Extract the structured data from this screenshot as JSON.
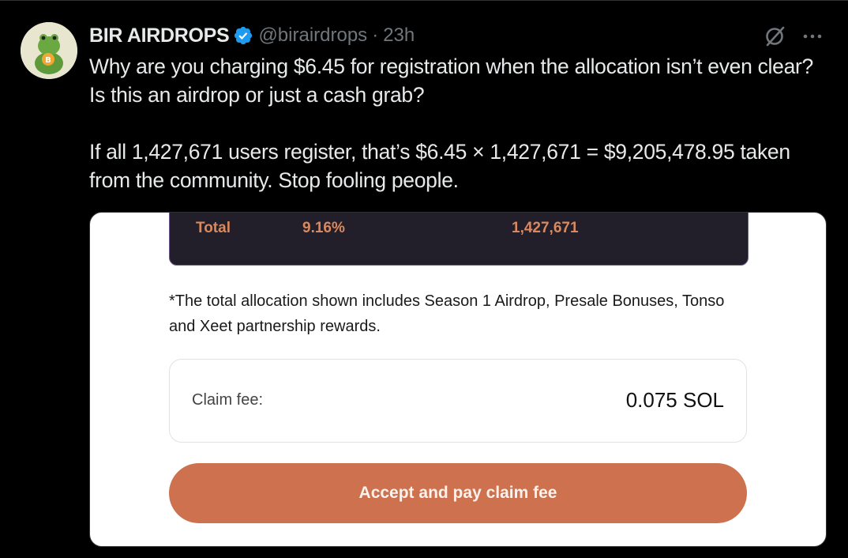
{
  "tweet": {
    "author_name": "BIR AIRDROPS",
    "handle": "@birairdrops",
    "separator": "·",
    "time": "23h",
    "more_label": "···",
    "text_line1": "Why are you charging $6.45 for registration when the allocation isn’t even clear? Is this an airdrop or just a cash grab?",
    "text_line2": "If all 1,427,671 users register, that’s $6.45 × 1,427,671 = $9,205,478.95 taken from the community. Stop fooling people."
  },
  "media": {
    "total_label": "Total",
    "total_percent": "9.16%",
    "total_users": "1,427,671",
    "note": "*The total allocation shown includes Season 1 Airdrop, Presale Bonuses, Tonso and Xeet partnership rewards.",
    "claim_fee_label": "Claim fee:",
    "claim_fee_value": "0.075 SOL",
    "accept_button": "Accept and pay claim fee"
  },
  "colors": {
    "background": "#000000",
    "text": "#e7e9ea",
    "muted": "#71767b",
    "verified": "#1d9bf0",
    "accent_orange": "#cd714f",
    "table_dark": "#231f2a"
  },
  "icons": {
    "verified": "verified-badge-icon",
    "grok": "grok-icon",
    "more": "more-icon",
    "avatar": "frog-avatar-icon"
  }
}
